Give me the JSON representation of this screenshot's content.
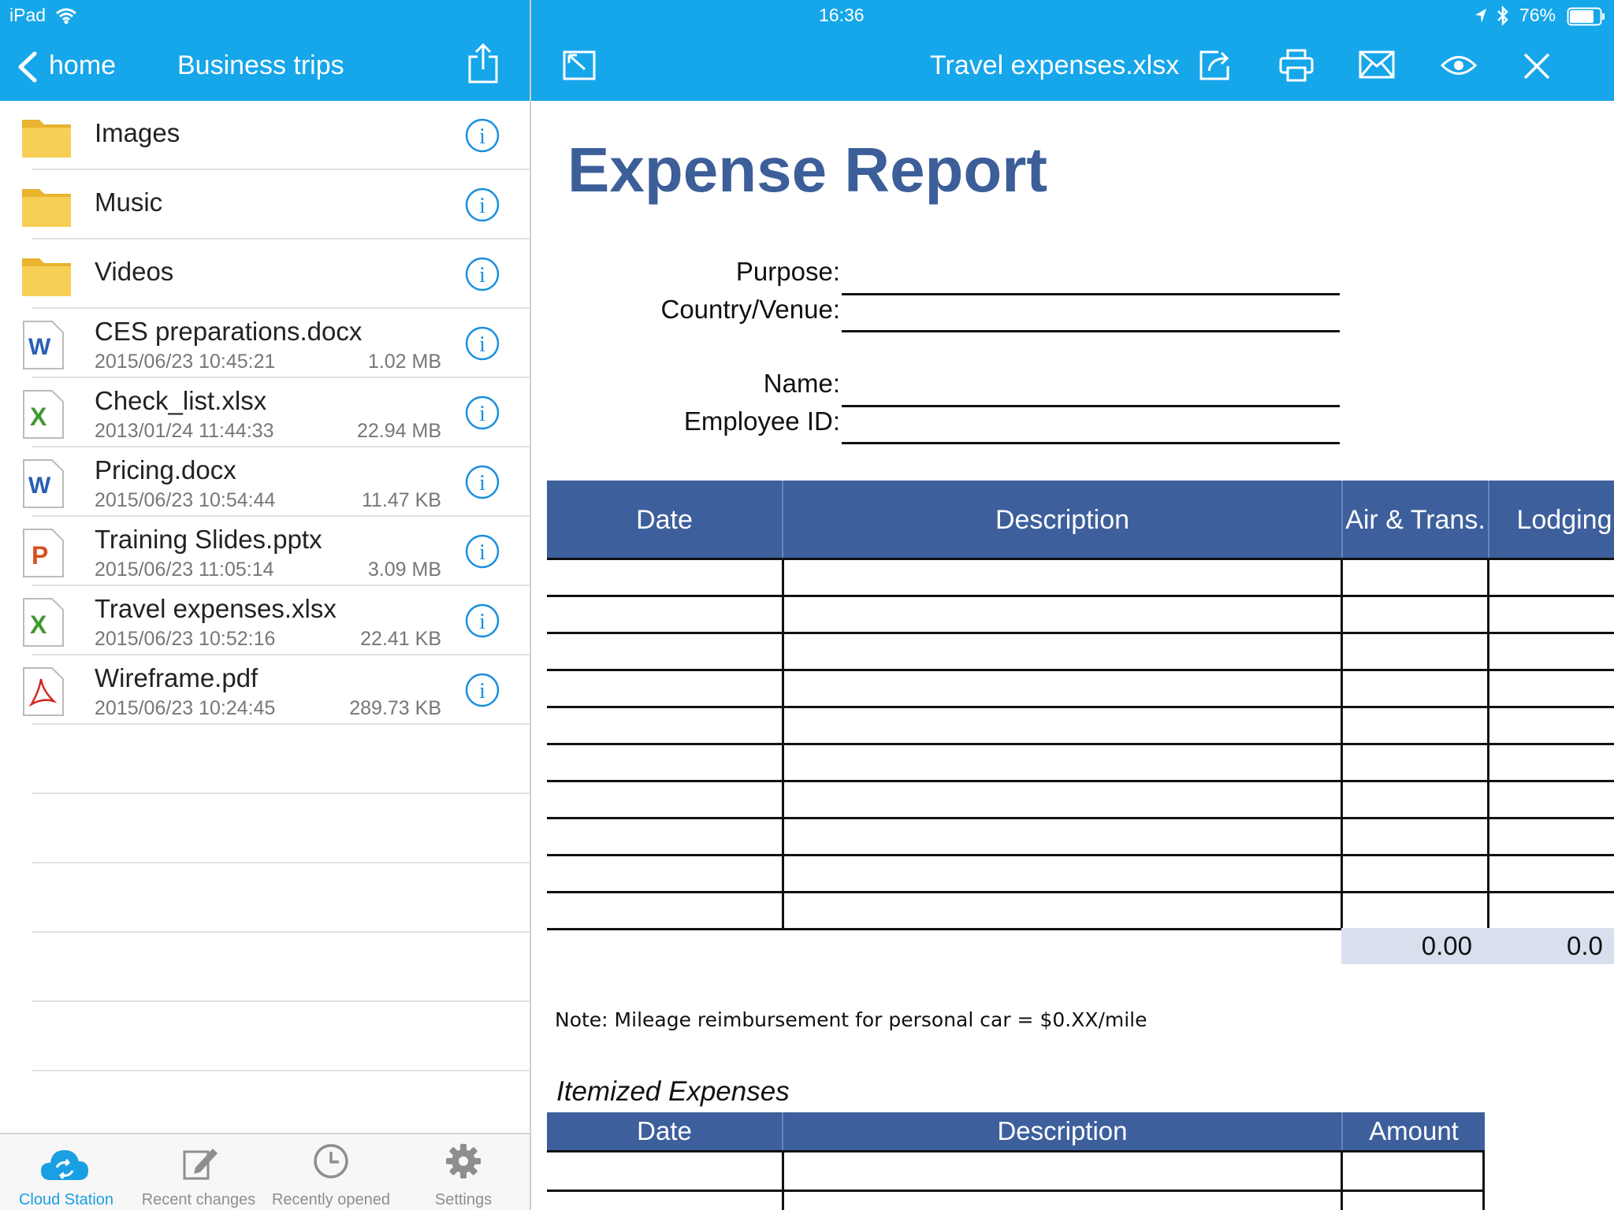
{
  "status_bar": {
    "device": "iPad",
    "time": "16:36",
    "battery": "76%"
  },
  "left_nav": {
    "back_label": "home",
    "title": "Business trips"
  },
  "viewer": {
    "filename": "Travel expenses.xlsx"
  },
  "files": [
    {
      "name": "Images",
      "type": "folder",
      "icon": "folder-icon"
    },
    {
      "name": "Music",
      "type": "folder",
      "icon": "folder-icon"
    },
    {
      "name": "Videos",
      "type": "folder",
      "icon": "folder-icon"
    },
    {
      "name": "CES preparations.docx",
      "type": "word",
      "date": "2015/06/23 10:45:21",
      "size": "1.02 MB",
      "icon": "word-file-icon"
    },
    {
      "name": "Check_list.xlsx",
      "type": "excel",
      "date": "2013/01/24 11:44:33",
      "size": "22.94 MB",
      "icon": "excel-file-icon"
    },
    {
      "name": "Pricing.docx",
      "type": "word",
      "date": "2015/06/23 10:54:44",
      "size": "11.47 KB",
      "icon": "word-file-icon"
    },
    {
      "name": "Training Slides.pptx",
      "type": "powerpoint",
      "date": "2015/06/23 11:05:14",
      "size": "3.09 MB",
      "icon": "powerpoint-file-icon"
    },
    {
      "name": "Travel expenses.xlsx",
      "type": "excel",
      "date": "2015/06/23 10:52:16",
      "size": "22.41 KB",
      "icon": "excel-file-icon"
    },
    {
      "name": "Wireframe.pdf",
      "type": "pdf",
      "date": "2015/06/23 10:24:45",
      "size": "289.73 KB",
      "icon": "pdf-file-icon"
    }
  ],
  "tabs": [
    {
      "label": "Cloud Station",
      "icon": "cloud-sync-icon",
      "active": true
    },
    {
      "label": "Recent changes",
      "icon": "edit-icon",
      "active": false
    },
    {
      "label": "Recently opened",
      "icon": "clock-icon",
      "active": false
    },
    {
      "label": "Settings",
      "icon": "gear-icon",
      "active": false
    }
  ],
  "document": {
    "title": "Expense Report",
    "fields": {
      "purpose": "Purpose:",
      "country": "Country/Venue:",
      "name": "Name:",
      "employee_id": "Employee ID:"
    },
    "table_headers": {
      "date": "Date",
      "description": "Description",
      "air": "Air & Trans.",
      "lodging": "Lodging"
    },
    "totals": {
      "air": "0.00",
      "lodging": "0.0"
    },
    "note": "Note: Mileage reimbursement for personal car = $0.XX/mile",
    "itemized_title": "Itemized Expenses",
    "itemized_headers": {
      "date": "Date",
      "description": "Description",
      "amount": "Amount"
    }
  },
  "colors": {
    "nav_blue": "#16a6ea",
    "report_blue": "#3d5f9c",
    "total_fill": "#d8e0ee",
    "tab_active": "#1a9fe3"
  }
}
